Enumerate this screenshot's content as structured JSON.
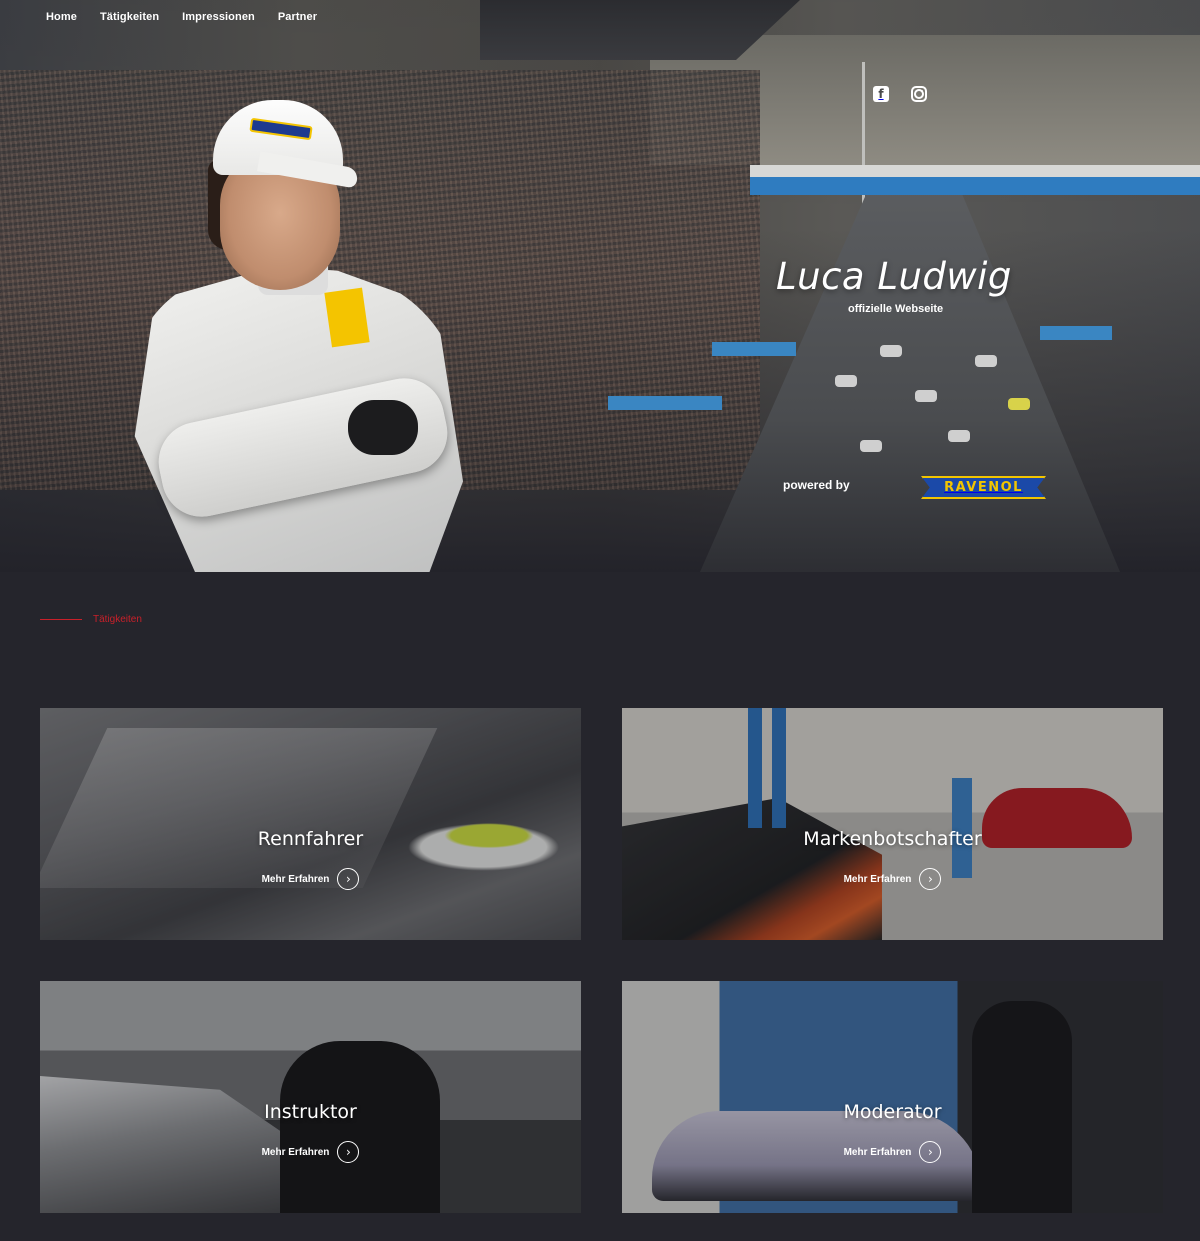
{
  "nav": {
    "items": [
      {
        "label": "Home"
      },
      {
        "label": "Tätigkeiten"
      },
      {
        "label": "Impressionen"
      },
      {
        "label": "Partner"
      }
    ]
  },
  "social": {
    "facebook_glyph": "f",
    "icons": [
      "facebook-icon",
      "instagram-icon"
    ]
  },
  "hero": {
    "title": "Luca Ludwig",
    "subtitle": "offizielle Webseite",
    "powered_by": "powered by",
    "sponsor_logo_text": "RAVENOL"
  },
  "section": {
    "label": "Tätigkeiten"
  },
  "cards": [
    {
      "title": "Rennfahrer",
      "cta": "Mehr Erfahren"
    },
    {
      "title": "Markenbotschafter",
      "cta": "Mehr Erfahren"
    },
    {
      "title": "Instruktor",
      "cta": "Mehr Erfahren"
    },
    {
      "title": "Moderator",
      "cta": "Mehr Erfahren"
    }
  ],
  "colors": {
    "background": "#25252c",
    "accent": "#c8202a",
    "sponsor_blue": "#1b49a8",
    "sponsor_yellow": "#f2c500"
  }
}
